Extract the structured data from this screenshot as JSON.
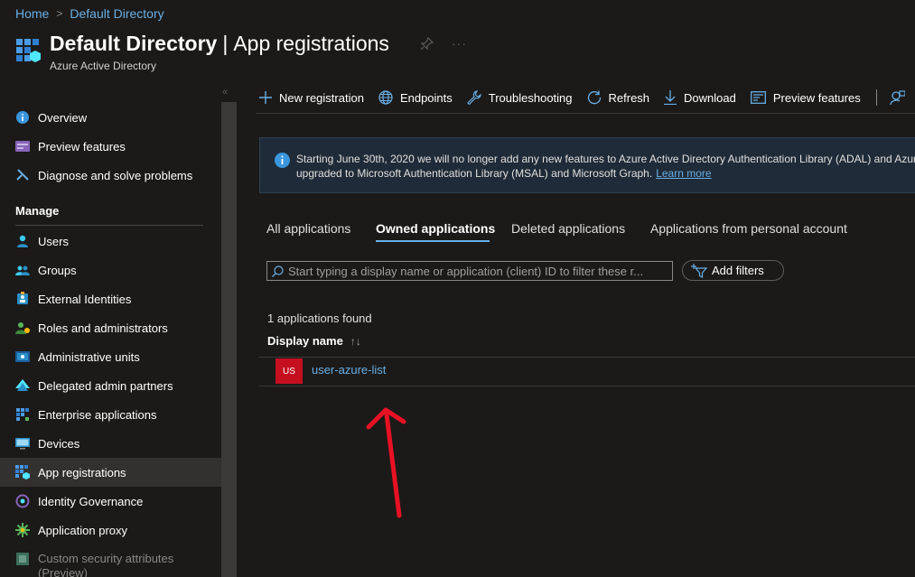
{
  "breadcrumb": {
    "home": "Home",
    "separator": ">",
    "current": "Default Directory"
  },
  "header": {
    "title_bold": "Default Directory",
    "title_sep": "|",
    "title_rest": "App registrations",
    "subtitle": "Azure Active Directory",
    "more": "···"
  },
  "sidebar": {
    "collapse": "«",
    "top_items": [
      {
        "label": "Overview",
        "icon": "info-icon"
      },
      {
        "label": "Preview features",
        "icon": "preview-icon"
      },
      {
        "label": "Diagnose and solve problems",
        "icon": "wrench-icon"
      }
    ],
    "section_heading": "Manage",
    "manage_items": [
      {
        "label": "Users",
        "icon": "user-icon"
      },
      {
        "label": "Groups",
        "icon": "groups-icon"
      },
      {
        "label": "External Identities",
        "icon": "external-identities-icon"
      },
      {
        "label": "Roles and administrators",
        "icon": "roles-icon"
      },
      {
        "label": "Administrative units",
        "icon": "admin-units-icon"
      },
      {
        "label": "Delegated admin partners",
        "icon": "partners-icon"
      },
      {
        "label": "Enterprise applications",
        "icon": "enterprise-apps-icon"
      },
      {
        "label": "Devices",
        "icon": "devices-icon"
      },
      {
        "label": "App registrations",
        "icon": "app-registrations-icon",
        "active": true
      },
      {
        "label": "Identity Governance",
        "icon": "governance-icon"
      },
      {
        "label": "Application proxy",
        "icon": "app-proxy-icon"
      },
      {
        "label": "Custom security attributes",
        "label2": "(Preview)",
        "icon": "custom-attributes-icon"
      }
    ]
  },
  "toolbar": {
    "new_registration": "New registration",
    "endpoints": "Endpoints",
    "troubleshooting": "Troubleshooting",
    "refresh": "Refresh",
    "download": "Download",
    "preview_features": "Preview features"
  },
  "banner": {
    "line1": "Starting June 30th, 2020 we will no longer add any new features to Azure Active Directory Authentication Library (ADAL) and Azure",
    "line2": "upgraded to Microsoft Authentication Library (MSAL) and Microsoft Graph.",
    "link": "Learn more"
  },
  "tabs": [
    {
      "label": "All applications"
    },
    {
      "label": "Owned applications",
      "active": true
    },
    {
      "label": "Deleted applications"
    },
    {
      "label": "Applications from personal account"
    }
  ],
  "filter": {
    "placeholder": "Start typing a display name or application (client) ID to filter these r...",
    "add_filters": "Add filters"
  },
  "results": {
    "count_text": "1 applications found",
    "column_header": "Display name",
    "sort_glyph": "↑↓",
    "rows": [
      {
        "badge": "US",
        "name": "user-azure-list",
        "badge_color": "#c50f1f"
      }
    ]
  },
  "colors": {
    "accent": "#69afe5",
    "background": "#1b1a19",
    "annotation_arrow": "#e81123"
  }
}
